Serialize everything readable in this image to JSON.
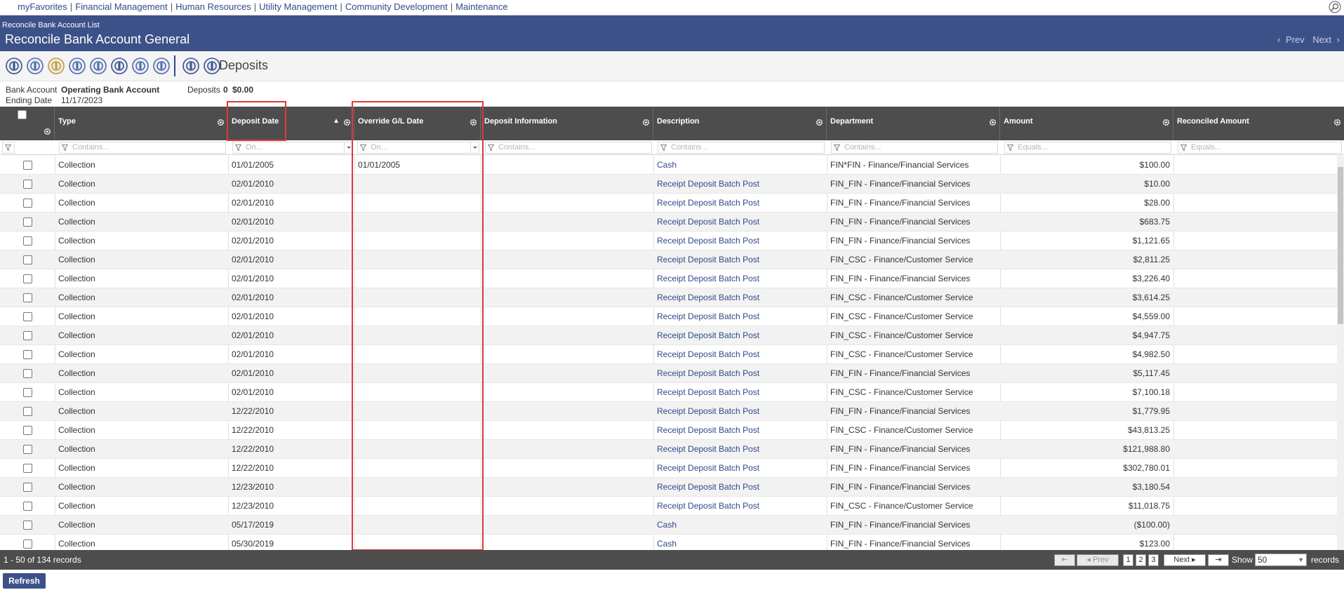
{
  "topnav": [
    "myFavorites",
    "Financial Management",
    "Human Resources",
    "Utility Management",
    "Community Development",
    "Maintenance"
  ],
  "header": {
    "breadcrumb": "Reconcile Bank Account List",
    "title": "Reconcile Bank Account General",
    "prev": "Prev",
    "next": "Next"
  },
  "toolbar": {
    "section": "Deposits",
    "icons": [
      "info-icon",
      "ledger-icon",
      "person-icon",
      "coins-icon",
      "bills-icon",
      "coin-stack-icon",
      "hand-coins-icon",
      "pen-ledger-icon",
      "copy-icon",
      "edit-icon"
    ]
  },
  "info": {
    "bank_account_label": "Bank Account",
    "bank_account_value": "Operating Bank Account",
    "ending_date_label": "Ending Date",
    "ending_date_value": "11/17/2023",
    "deposits_label": "Deposits",
    "deposits_count": "0",
    "deposits_amount": "$0.00"
  },
  "columns": [
    "Type",
    "Deposit Date",
    "Override G/L Date",
    "Deposit Information",
    "Description",
    "Department",
    "Amount",
    "Reconciled Amount"
  ],
  "filters": {
    "type": "Contains...",
    "deposit_date": "On...",
    "override": "On...",
    "info": "Contains...",
    "description": "Contains...",
    "department": "Contains...",
    "amount": "Equals...",
    "reconciled": "Equals..."
  },
  "rows": [
    {
      "type": "Collection",
      "date": "01/01/2005",
      "override": "01/01/2005",
      "desc": "Cash",
      "dept": "FIN*FIN - Finance/Financial Services",
      "amount": "$100.00"
    },
    {
      "type": "Collection",
      "date": "02/01/2010",
      "override": "",
      "desc": "Receipt Deposit Batch Post",
      "dept": "FIN_FIN - Finance/Financial Services",
      "amount": "$10.00"
    },
    {
      "type": "Collection",
      "date": "02/01/2010",
      "override": "",
      "desc": "Receipt Deposit Batch Post",
      "dept": "FIN_FIN - Finance/Financial Services",
      "amount": "$28.00"
    },
    {
      "type": "Collection",
      "date": "02/01/2010",
      "override": "",
      "desc": "Receipt Deposit Batch Post",
      "dept": "FIN_FIN - Finance/Financial Services",
      "amount": "$683.75"
    },
    {
      "type": "Collection",
      "date": "02/01/2010",
      "override": "",
      "desc": "Receipt Deposit Batch Post",
      "dept": "FIN_FIN - Finance/Financial Services",
      "amount": "$1,121.65"
    },
    {
      "type": "Collection",
      "date": "02/01/2010",
      "override": "",
      "desc": "Receipt Deposit Batch Post",
      "dept": "FIN_CSC - Finance/Customer Service",
      "amount": "$2,811.25"
    },
    {
      "type": "Collection",
      "date": "02/01/2010",
      "override": "",
      "desc": "Receipt Deposit Batch Post",
      "dept": "FIN_FIN - Finance/Financial Services",
      "amount": "$3,226.40"
    },
    {
      "type": "Collection",
      "date": "02/01/2010",
      "override": "",
      "desc": "Receipt Deposit Batch Post",
      "dept": "FIN_CSC - Finance/Customer Service",
      "amount": "$3,614.25"
    },
    {
      "type": "Collection",
      "date": "02/01/2010",
      "override": "",
      "desc": "Receipt Deposit Batch Post",
      "dept": "FIN_CSC - Finance/Customer Service",
      "amount": "$4,559.00"
    },
    {
      "type": "Collection",
      "date": "02/01/2010",
      "override": "",
      "desc": "Receipt Deposit Batch Post",
      "dept": "FIN_CSC - Finance/Customer Service",
      "amount": "$4,947.75"
    },
    {
      "type": "Collection",
      "date": "02/01/2010",
      "override": "",
      "desc": "Receipt Deposit Batch Post",
      "dept": "FIN_CSC - Finance/Customer Service",
      "amount": "$4,982.50"
    },
    {
      "type": "Collection",
      "date": "02/01/2010",
      "override": "",
      "desc": "Receipt Deposit Batch Post",
      "dept": "FIN_FIN - Finance/Financial Services",
      "amount": "$5,117.45"
    },
    {
      "type": "Collection",
      "date": "02/01/2010",
      "override": "",
      "desc": "Receipt Deposit Batch Post",
      "dept": "FIN_CSC - Finance/Customer Service",
      "amount": "$7,100.18"
    },
    {
      "type": "Collection",
      "date": "12/22/2010",
      "override": "",
      "desc": "Receipt Deposit Batch Post",
      "dept": "FIN_FIN - Finance/Financial Services",
      "amount": "$1,779.95"
    },
    {
      "type": "Collection",
      "date": "12/22/2010",
      "override": "",
      "desc": "Receipt Deposit Batch Post",
      "dept": "FIN_CSC - Finance/Customer Service",
      "amount": "$43,813.25"
    },
    {
      "type": "Collection",
      "date": "12/22/2010",
      "override": "",
      "desc": "Receipt Deposit Batch Post",
      "dept": "FIN_FIN - Finance/Financial Services",
      "amount": "$121,988.80"
    },
    {
      "type": "Collection",
      "date": "12/22/2010",
      "override": "",
      "desc": "Receipt Deposit Batch Post",
      "dept": "FIN_FIN - Finance/Financial Services",
      "amount": "$302,780.01"
    },
    {
      "type": "Collection",
      "date": "12/23/2010",
      "override": "",
      "desc": "Receipt Deposit Batch Post",
      "dept": "FIN_FIN - Finance/Financial Services",
      "amount": "$3,180.54"
    },
    {
      "type": "Collection",
      "date": "12/23/2010",
      "override": "",
      "desc": "Receipt Deposit Batch Post",
      "dept": "FIN_CSC - Finance/Customer Service",
      "amount": "$11,018.75"
    },
    {
      "type": "Collection",
      "date": "05/17/2019",
      "override": "",
      "desc": "Cash",
      "dept": "FIN_FIN - Finance/Financial Services",
      "amount": "($100.00)"
    },
    {
      "type": "Collection",
      "date": "05/30/2019",
      "override": "",
      "desc": "Cash",
      "dept": "FIN_FIN - Finance/Financial Services",
      "amount": "$123.00"
    }
  ],
  "footer": {
    "record_count": "1 - 50 of 134 records",
    "prev": "Prev",
    "pages": [
      "1",
      "2",
      "3"
    ],
    "next": "Next",
    "show_label": "Show",
    "show_value": "50",
    "records_label": "records"
  },
  "refresh_label": "Refresh",
  "colors": {
    "brand_blue": "#3d5189",
    "grid_header": "#4d4d4d",
    "link": "#2f4a8a",
    "highlight": "#e0383a"
  }
}
